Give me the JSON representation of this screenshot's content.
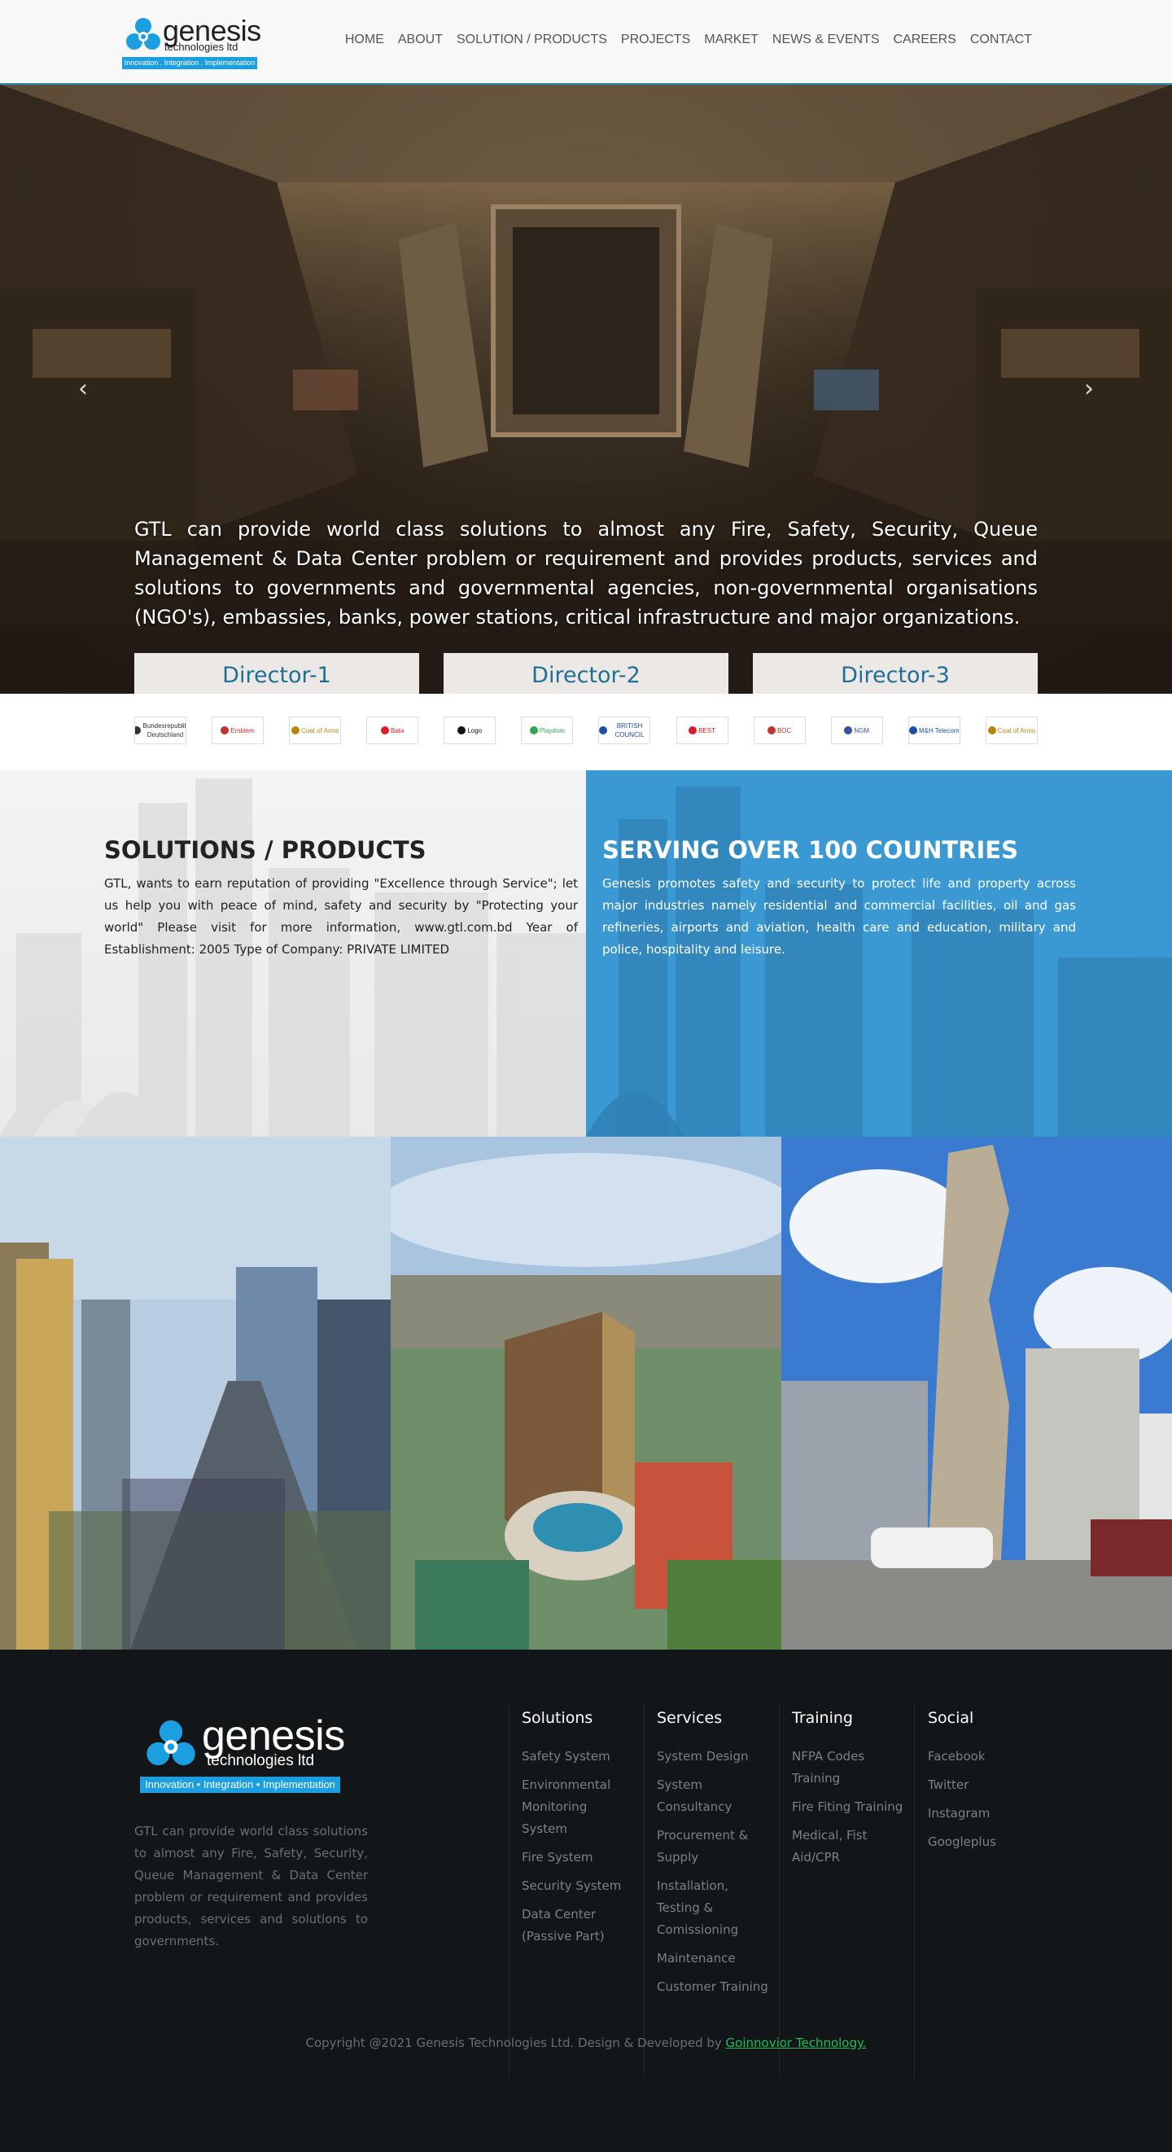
{
  "brand": {
    "name": "genesis",
    "sub": "technologies ltd",
    "tagline": "Innovation . Integration . Implementation",
    "footer_tagline": "Innovation • Integration • Implementation"
  },
  "nav": [
    "HOME",
    "ABOUT",
    "SOLUTION / PRODUCTS",
    "PROJECTS",
    "MARKET",
    "NEWS & EVENTS",
    "CAREERS",
    "CONTACT"
  ],
  "hero": {
    "prev": "‹",
    "next": "›",
    "text": "GTL can provide world class solutions to almost any Fire, Safety, Security, Queue Management & Data Center problem or requirement and provides products, services and solutions to governments and governmental agencies, non-governmental organisations (NGO's), embassies, banks, power stations, critical infrastructure and major organizations.",
    "directors": [
      "Director-1",
      "Director-2",
      "Director-3"
    ]
  },
  "clients": [
    {
      "label": "Bundesrepublik Deutschland",
      "color": "#333333"
    },
    {
      "label": "Emblem",
      "color": "#c53030"
    },
    {
      "label": "Coat of Arms",
      "color": "#b8860b"
    },
    {
      "label": "Bata",
      "color": "#d81e2a"
    },
    {
      "label": "Logo",
      "color": "#111111"
    },
    {
      "label": "Playdom",
      "color": "#2fa84f"
    },
    {
      "label": "BRITISH COUNCIL",
      "color": "#1f4fa3"
    },
    {
      "label": "BEST",
      "color": "#d81e2a"
    },
    {
      "label": "BOC",
      "color": "#c53030"
    },
    {
      "label": "NGM",
      "color": "#3a4fa0"
    },
    {
      "label": "M&H Telecom",
      "color": "#1f4fa3"
    },
    {
      "label": "Coat of Arms",
      "color": "#b8860b"
    }
  ],
  "solutions_panel": {
    "title": "SOLUTIONS / PRODUCTS",
    "body": "GTL, wants to earn reputation of providing \"Excellence through Service\"; let us help you with peace of mind, safety and security by \"Protecting your world\" Please visit for more information, www.gtl.com.bd Year of Establishment: 2005 Type of Company: PRIVATE LIMITED"
  },
  "countries_panel": {
    "title": "SERVING OVER 100 COUNTRIES",
    "body": "Genesis promotes safety and security to protect life and property across major industries namely residential and commercial facilities, oil and gas refineries, airports and aviation, health care and education, military and police, hospitality and leisure."
  },
  "footer": {
    "about": "GTL can provide world class solutions to almost any Fire, Safety, Security, Queue Management & Data Center problem or requirement and provides products, services and solutions to governments.",
    "columns": [
      {
        "title": "Solutions",
        "links": [
          "Safety System",
          "Environmental Monitoring System",
          "Fire System",
          "Security System",
          "Data Center (Passive Part)"
        ]
      },
      {
        "title": "Services",
        "links": [
          "System Design",
          "System Consultancy",
          "Procurement & Supply",
          "Installation, Testing & Comissioning",
          "Maintenance",
          "Customer Training"
        ]
      },
      {
        "title": "Training",
        "links": [
          "NFPA Codes Training",
          "Fire Fiting Training",
          "Medical, Fist Aid/CPR"
        ]
      },
      {
        "title": "Social",
        "links": [
          "Facebook",
          "Twitter",
          "Instagram",
          "Googleplus"
        ]
      }
    ],
    "copyright": "Copyright @2021 Genesis Technologies Ltd. Design & Developed by",
    "developer": "Goinnovior Technology."
  }
}
